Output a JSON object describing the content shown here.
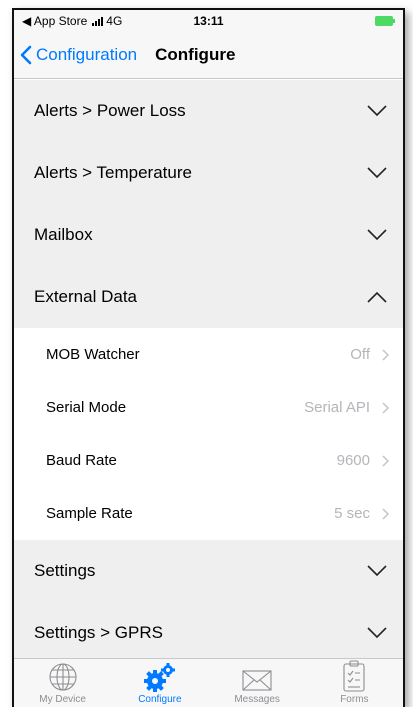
{
  "status_bar": {
    "carrier_back": "◀ App Store",
    "network": "4G",
    "time": "13:11"
  },
  "nav": {
    "back_label": "Configuration",
    "title": "Configure"
  },
  "sections": [
    {
      "label": "Alerts > Power Loss",
      "expanded": false
    },
    {
      "label": "Alerts > Temperature",
      "expanded": false
    },
    {
      "label": "Mailbox",
      "expanded": false
    },
    {
      "label": "External Data",
      "expanded": true,
      "rows": [
        {
          "label": "MOB Watcher",
          "value": "Off"
        },
        {
          "label": "Serial Mode",
          "value": "Serial API"
        },
        {
          "label": "Baud Rate",
          "value": "9600"
        },
        {
          "label": "Sample Rate",
          "value": "5 sec"
        }
      ]
    },
    {
      "label": "Settings",
      "expanded": false
    },
    {
      "label": "Settings > GPRS",
      "expanded": false
    }
  ],
  "tabs": [
    {
      "label": "My Device",
      "icon": "globe-icon",
      "active": false
    },
    {
      "label": "Configure",
      "icon": "gears-icon",
      "active": true
    },
    {
      "label": "Messages",
      "icon": "envelope-icon",
      "active": false
    },
    {
      "label": "Forms",
      "icon": "clipboard-icon",
      "active": false
    }
  ],
  "colors": {
    "accent": "#007aff",
    "section_bg": "#efefef",
    "inactive_tab": "#8e8e93",
    "battery": "#4cd964"
  }
}
